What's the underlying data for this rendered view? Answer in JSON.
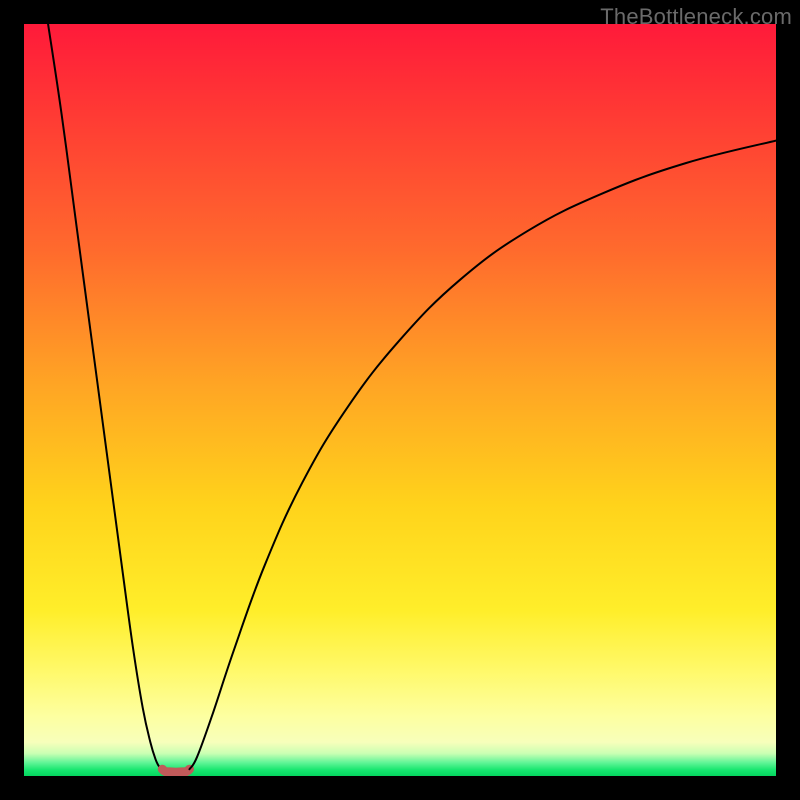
{
  "watermark": {
    "text": "TheBottleneck.com"
  },
  "chart_data": {
    "type": "line",
    "title": "",
    "xlabel": "",
    "ylabel": "",
    "xlim": [
      0,
      100
    ],
    "ylim": [
      0,
      100
    ],
    "grid": false,
    "legend": false,
    "annotations": [],
    "series": [
      {
        "name": "left-descent",
        "stroke": "#000000",
        "x": [
          3.2,
          5,
          7,
          9,
          11,
          13,
          14.5,
          15.8,
          16.8,
          17.5,
          18.0,
          18.4
        ],
        "y": [
          100,
          88,
          73,
          58,
          43,
          28,
          17,
          9,
          4.5,
          2.2,
          1.2,
          0.9
        ]
      },
      {
        "name": "dip-bottom",
        "stroke": "#c15a5a",
        "x": [
          18.4,
          18.8,
          19.4,
          20.2,
          21.0,
          21.6,
          22.0
        ],
        "y": [
          0.9,
          0.6,
          0.55,
          0.5,
          0.55,
          0.6,
          0.9
        ]
      },
      {
        "name": "right-ascent",
        "stroke": "#000000",
        "x": [
          22.0,
          23.0,
          25.0,
          28.0,
          32.0,
          37.0,
          43.0,
          50.0,
          58.0,
          67.0,
          77.0,
          88.0,
          100.0
        ],
        "y": [
          0.9,
          2.5,
          8.0,
          17.0,
          28.0,
          39.0,
          49.0,
          58.0,
          66.0,
          72.5,
          77.5,
          81.5,
          84.5
        ]
      }
    ],
    "background_gradient": {
      "direction": "vertical",
      "stops": [
        {
          "pos": 0.0,
          "color": "#ff1a3a"
        },
        {
          "pos": 0.3,
          "color": "#ff6a2d"
        },
        {
          "pos": 0.64,
          "color": "#ffd31b"
        },
        {
          "pos": 0.92,
          "color": "#fdffa0"
        },
        {
          "pos": 0.99,
          "color": "#17e66f"
        },
        {
          "pos": 1.0,
          "color": "#04d65f"
        }
      ]
    }
  }
}
